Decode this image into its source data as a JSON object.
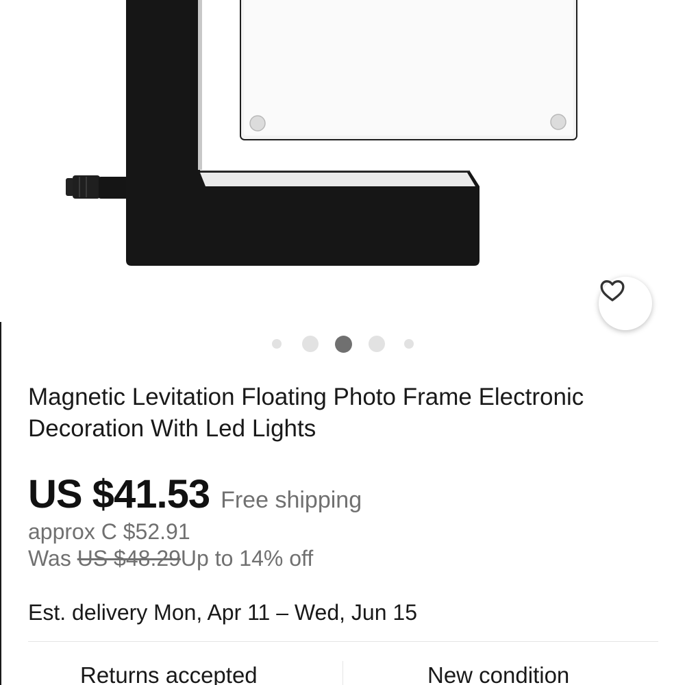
{
  "product": {
    "title": "Magnetic Levitation Floating Photo Frame Electronic Decoration With Led Lights",
    "price": "US $41.53",
    "shipping": "Free shipping",
    "approx_price": "approx C $52.91",
    "was_label": "Was",
    "was_price": "US $48.29",
    "discount": "Up to 14% off",
    "delivery": "Est. delivery Mon, Apr 11 – Wed, Jun 15"
  },
  "gallery": {
    "image_count": 5,
    "active_index": 2,
    "active_dot_color": "#707070",
    "inactive_dot_color": "#e2e2e2"
  },
  "actions": {
    "favorite_icon": "heart-outline-icon"
  },
  "features": {
    "returns": "Returns accepted",
    "condition": "New condition"
  }
}
